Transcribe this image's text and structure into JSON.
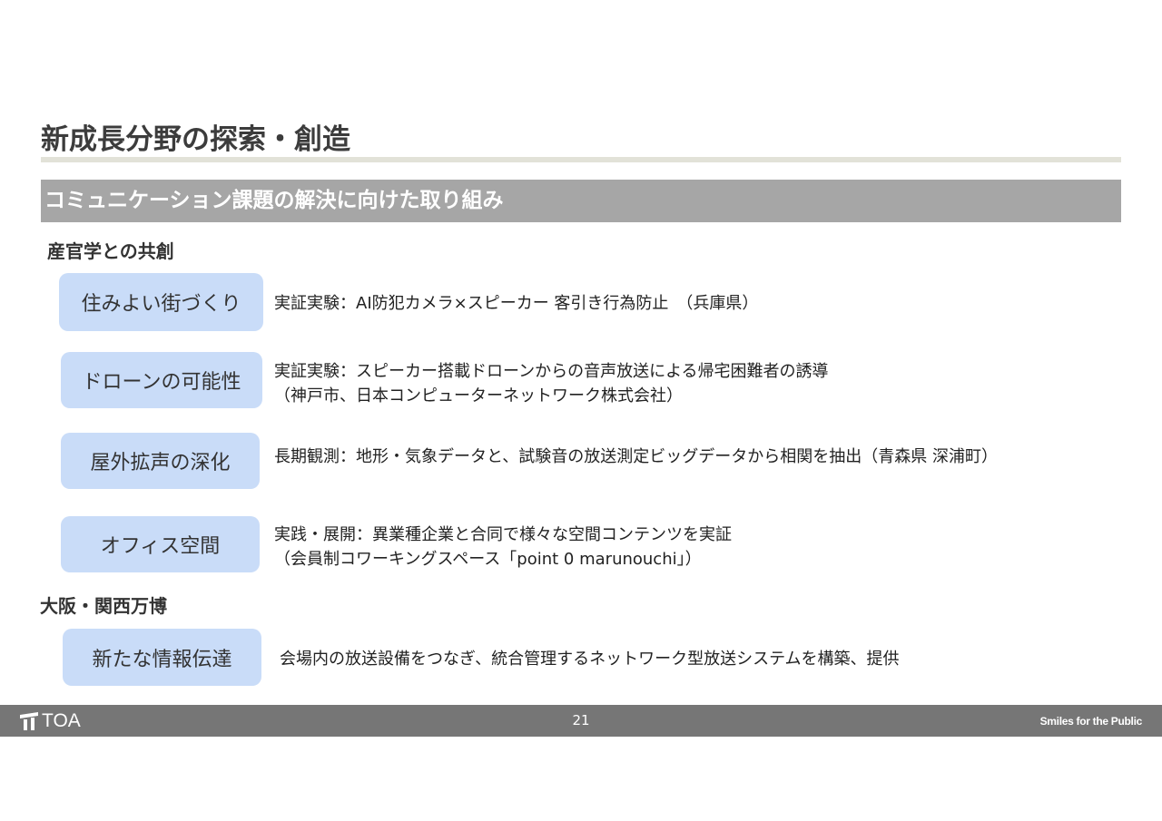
{
  "title": "新成長分野の探索・創造",
  "section_bar": "コミュニケーション課題の解決に向けた取り組み",
  "groups": [
    {
      "heading": "産官学との共創",
      "items": [
        {
          "label": "住みよい街づくり",
          "lines": [
            "実証実験：AI防犯カメラ×スピーカー 客引き行為防止　（兵庫県）"
          ]
        },
        {
          "label": "ドローンの可能性",
          "lines": [
            "実証実験：スピーカー搭載ドローンからの音声放送による帰宅困難者の誘導",
            "（神戸市、日本コンピューターネットワーク株式会社）"
          ]
        },
        {
          "label": "屋外拡声の深化",
          "lines": [
            "長期観測：地形・気象データと、試験音の放送測定ビッグデータから相関を抽出（青森県 深浦町）"
          ]
        },
        {
          "label": "オフィス空間",
          "lines": [
            "実践・展開：異業種企業と合同で様々な空間コンテンツを実証",
            "（会員制コワーキングスペース「point 0 marunouchi」）"
          ]
        }
      ]
    },
    {
      "heading": "大阪・関西万博",
      "items": [
        {
          "label": "新たな情報伝達",
          "lines": [
            "会場内の放送設備をつなぎ、統合管理するネットワーク型放送システムを構築、提供"
          ]
        }
      ]
    }
  ],
  "footer": {
    "logo_text": "TOA",
    "page_number": "21",
    "tagline": "Smiles for the Public"
  },
  "colors": {
    "pill": "#c9dcf8",
    "section_bar": "#a6a6a6",
    "footer": "#767676",
    "title_rule": "#e2e2d8"
  }
}
